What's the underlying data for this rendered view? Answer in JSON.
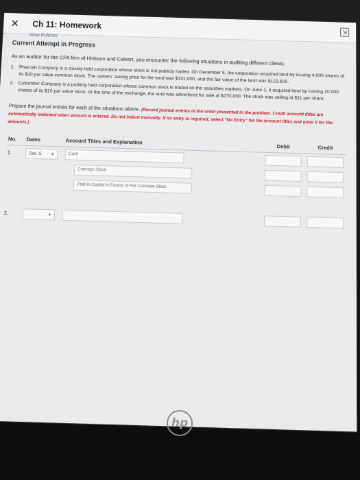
{
  "window": {
    "title": "Ch 11: Homework",
    "close_glyph": "✕",
    "expand_glyph": "⇲",
    "policies_link": "View Policies"
  },
  "assignment": {
    "status": "Current Attempt in Progress",
    "intro": "As an auditor for the CPA firm of Hinkson and Calvert, you encounter the following situations in auditing different clients.",
    "problems": [
      {
        "num": "1.",
        "text": "Pharoah Company is a closely held corporation whose stock is not publicly traded. On December 5, the corporation acquired land by issuing 4,000 shares of its $20 par value common stock. The owners' asking price for the land was $131,000, and the fair value of the land was $123,500."
      },
      {
        "num": "2.",
        "text": "Cullumber Company is a publicly held corporation whose common stock is traded on the securities markets. On June 1, it acquired land by issuing 20,000 shares of its $10 par value stock. At the time of the exchange, the land was advertised for sale at $270,000. The stock was selling at $11 per share."
      }
    ],
    "instructions": "Prepare the journal entries for each of the situations above.",
    "instructions_red": "(Record journal entries in the order presented in the problem. Credit account titles are automatically indented when amount is entered. Do not indent manually. If no entry is required, select \"No Entry\" for the account titles and enter 0 for the amounts.)"
  },
  "journal": {
    "headers": {
      "no": "No.",
      "date": "Dates",
      "account": "Account Titles and Explanation",
      "debit": "Debit",
      "credit": "Credit"
    },
    "entries": [
      {
        "no": "1.",
        "date": "Dec. 5",
        "rows": [
          {
            "account": "Cash",
            "indent": false
          },
          {
            "account": "Common Stock",
            "indent": true
          },
          {
            "account": "Paid-in Capital in Excess of Par-Common Stock",
            "indent": true
          }
        ]
      },
      {
        "no": "2.",
        "date": "",
        "rows": [
          {
            "account": "",
            "indent": false
          }
        ]
      }
    ]
  },
  "brand": {
    "logo_text": "hp"
  }
}
